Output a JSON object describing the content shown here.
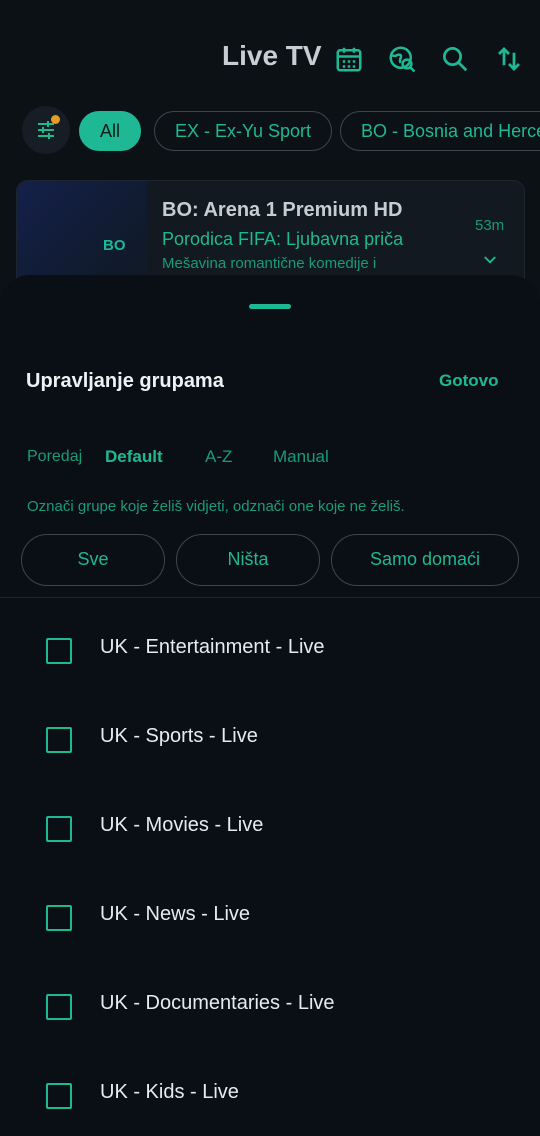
{
  "header": {
    "title": "Live TV",
    "icons": [
      "calendar-icon",
      "search-globe-icon",
      "search-icon",
      "sort-icon"
    ]
  },
  "chips": [
    {
      "label": "All",
      "active": true
    },
    {
      "label": "EX - Ex-Yu Sport",
      "active": false
    },
    {
      "label": "BO - Bosnia and Herce",
      "active": false
    }
  ],
  "channel": {
    "logo_text": "BO",
    "name": "BO: Arena 1 Premium HD",
    "program": "Porodica FIFA: Ljubavna priča",
    "description": "Mešavina romantične komedije i",
    "time_left": "53m"
  },
  "sheet": {
    "title": "Upravljanje grupama",
    "done_label": "Gotovo",
    "sort_label": "Poredaj",
    "sort_options": [
      {
        "label": "Default",
        "active": true
      },
      {
        "label": "A-Z",
        "active": false
      },
      {
        "label": "Manual",
        "active": false
      }
    ],
    "hint": "Označi grupe koje želiš vidjeti, odznači one koje ne želiš.",
    "quick_buttons": [
      "Sve",
      "Ništa",
      "Samo domaći"
    ],
    "groups": [
      {
        "label": "UK - Entertainment - Live",
        "checked": false
      },
      {
        "label": "UK - Sports - Live",
        "checked": false
      },
      {
        "label": "UK - Movies - Live",
        "checked": false
      },
      {
        "label": "UK - News - Live",
        "checked": false
      },
      {
        "label": "UK - Documentaries - Live",
        "checked": false
      },
      {
        "label": "UK - Kids - Live",
        "checked": false
      }
    ]
  },
  "colors": {
    "accent": "#1fb894",
    "background": "#0c1116",
    "sheet": "#0a0f15",
    "badge": "#e3a020"
  }
}
